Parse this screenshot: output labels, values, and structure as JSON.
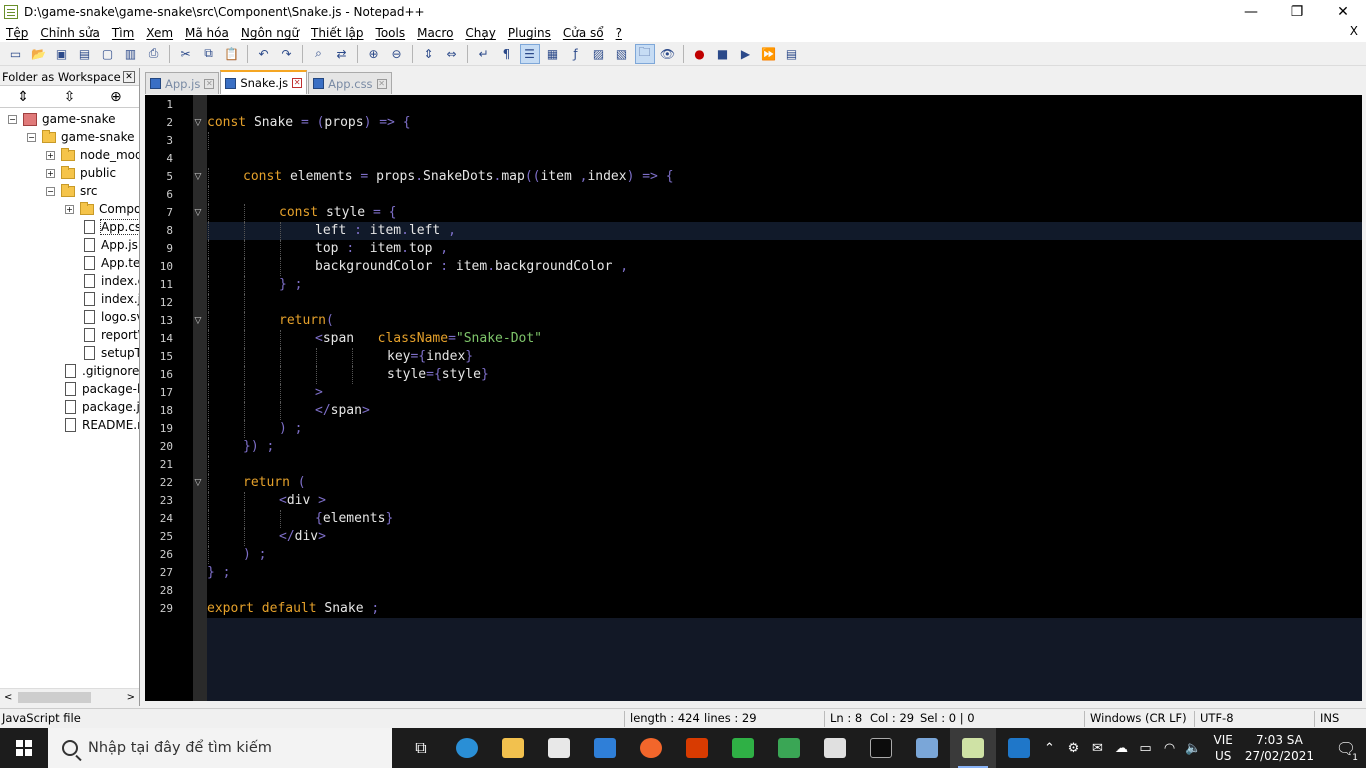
{
  "window": {
    "title": "D:\\game-snake\\game-snake\\src\\Component\\Snake.js - Notepad++",
    "controls": {
      "minimize": "—",
      "maximize": "❐",
      "close": "✕"
    }
  },
  "menu": {
    "items": [
      "Tệp",
      "Chỉnh sửa",
      "Tìm",
      "Xem",
      "Mã hóa",
      "Ngôn ngữ",
      "Thiết lập",
      "Tools",
      "Macro",
      "Chạy",
      "Plugins",
      "Cửa sổ",
      "?"
    ],
    "close": "X"
  },
  "toolbar": {
    "icons": [
      "new-file-icon",
      "open-file-icon",
      "save-icon",
      "save-all-icon",
      "close-icon",
      "close-all-icon",
      "print-icon",
      "cut-icon",
      "copy-icon",
      "paste-icon",
      "undo-icon",
      "redo-icon",
      "find-icon",
      "replace-icon",
      "zoom-in-icon",
      "zoom-out-icon",
      "sync-vertical-icon",
      "sync-horizontal-icon",
      "word-wrap-icon",
      "show-all-chars-icon",
      "indent-guide-icon",
      "doc-map-icon",
      "function-list-icon",
      "folder-workspace-icon",
      "monitoring-icon",
      "record-macro-icon",
      "stop-record-icon",
      "play-macro-icon",
      "run-macro-multiple-icon",
      "save-macro-icon"
    ]
  },
  "panel": {
    "title": "Folder as Workspace",
    "close": "✕",
    "tree": [
      {
        "label": "game-snake",
        "type": "project",
        "level": 0,
        "expander": "−"
      },
      {
        "label": "game-snake",
        "type": "folder",
        "level": 1,
        "expander": "−"
      },
      {
        "label": "node_modules",
        "type": "folder",
        "level": 2,
        "expander": "+"
      },
      {
        "label": "public",
        "type": "folder",
        "level": 2,
        "expander": "+"
      },
      {
        "label": "src",
        "type": "folder",
        "level": 2,
        "expander": "−"
      },
      {
        "label": "Component",
        "type": "folder",
        "level": 3,
        "expander": "+"
      },
      {
        "label": "App.css",
        "type": "file",
        "level": 3,
        "selected": true
      },
      {
        "label": "App.js",
        "type": "file",
        "level": 3
      },
      {
        "label": "App.test.js",
        "type": "file",
        "level": 3
      },
      {
        "label": "index.css",
        "type": "file",
        "level": 3
      },
      {
        "label": "index.js",
        "type": "file",
        "level": 3
      },
      {
        "label": "logo.svg",
        "type": "file",
        "level": 3
      },
      {
        "label": "reportWebVitals.js",
        "type": "file",
        "level": 3
      },
      {
        "label": "setupTests.js",
        "type": "file",
        "level": 3
      },
      {
        "label": ".gitignore",
        "type": "file",
        "level": 2
      },
      {
        "label": "package-lock.json",
        "type": "file",
        "level": 2
      },
      {
        "label": "package.json",
        "type": "file",
        "level": 2
      },
      {
        "label": "README.md",
        "type": "file",
        "level": 2
      }
    ]
  },
  "tabs": [
    {
      "label": "App.js",
      "active": false
    },
    {
      "label": "Snake.js",
      "active": true
    },
    {
      "label": "App.css",
      "active": false
    }
  ],
  "editor": {
    "current_line": 8,
    "lines": [
      {
        "n": 1,
        "fold": "",
        "indent": 0,
        "tokens": []
      },
      {
        "n": 2,
        "fold": "▽",
        "indent": 0,
        "tokens": [
          [
            "kw",
            "const"
          ],
          [
            "pl",
            " Snake "
          ],
          [
            "op",
            "= ("
          ],
          [
            "pl",
            "props"
          ],
          [
            "op",
            ") => {"
          ]
        ]
      },
      {
        "n": 3,
        "fold": "",
        "indent": 1,
        "tokens": []
      },
      {
        "n": 4,
        "fold": "",
        "indent": 0,
        "tokens": []
      },
      {
        "n": 5,
        "fold": "▽",
        "indent": 1,
        "tokens": [
          [
            "kw",
            "const"
          ],
          [
            "pl",
            " elements "
          ],
          [
            "op",
            "="
          ],
          [
            "pl",
            " props"
          ],
          [
            "op",
            "."
          ],
          [
            "pl",
            "SnakeDots"
          ],
          [
            "op",
            "."
          ],
          [
            "pl",
            "map"
          ],
          [
            "op",
            "(("
          ],
          [
            "pl",
            "item "
          ],
          [
            "op",
            ","
          ],
          [
            "pl",
            "index"
          ],
          [
            "op",
            ") => {"
          ]
        ]
      },
      {
        "n": 6,
        "fold": "",
        "indent": 1,
        "tokens": []
      },
      {
        "n": 7,
        "fold": "▽",
        "indent": 2,
        "tokens": [
          [
            "kw",
            "const"
          ],
          [
            "pl",
            " style "
          ],
          [
            "op",
            "= {"
          ]
        ]
      },
      {
        "n": 8,
        "fold": "",
        "indent": 3,
        "tokens": [
          [
            "pl",
            "left "
          ],
          [
            "op",
            ":"
          ],
          [
            "pl",
            " item"
          ],
          [
            "op",
            "."
          ],
          [
            "pl",
            "left "
          ],
          [
            "op",
            ","
          ]
        ]
      },
      {
        "n": 9,
        "fold": "",
        "indent": 3,
        "tokens": [
          [
            "pl",
            "top "
          ],
          [
            "op",
            ":"
          ],
          [
            "pl",
            "  item"
          ],
          [
            "op",
            "."
          ],
          [
            "pl",
            "top "
          ],
          [
            "op",
            ","
          ]
        ]
      },
      {
        "n": 10,
        "fold": "",
        "indent": 3,
        "tokens": [
          [
            "pl",
            "backgroundColor "
          ],
          [
            "op",
            ":"
          ],
          [
            "pl",
            " item"
          ],
          [
            "op",
            "."
          ],
          [
            "pl",
            "backgroundColor "
          ],
          [
            "op",
            ","
          ]
        ]
      },
      {
        "n": 11,
        "fold": "",
        "indent": 2,
        "tokens": [
          [
            "op",
            "} ;"
          ]
        ]
      },
      {
        "n": 12,
        "fold": "",
        "indent": 2,
        "tokens": []
      },
      {
        "n": 13,
        "fold": "▽",
        "indent": 2,
        "tokens": [
          [
            "kw",
            "return"
          ],
          [
            "op",
            "("
          ]
        ]
      },
      {
        "n": 14,
        "fold": "",
        "indent": 3,
        "tokens": [
          [
            "op",
            "<"
          ],
          [
            "pl",
            "span   "
          ],
          [
            "kw",
            "className"
          ],
          [
            "op",
            "="
          ],
          [
            "str",
            "\"Snake-Dot\""
          ]
        ]
      },
      {
        "n": 15,
        "fold": "",
        "indent": 5,
        "tokens": [
          [
            "pl",
            "key"
          ],
          [
            "op",
            "={"
          ],
          [
            "pl",
            "index"
          ],
          [
            "op",
            "}"
          ]
        ]
      },
      {
        "n": 16,
        "fold": "",
        "indent": 5,
        "tokens": [
          [
            "pl",
            "style"
          ],
          [
            "op",
            "={"
          ],
          [
            "pl",
            "style"
          ],
          [
            "op",
            "}"
          ]
        ]
      },
      {
        "n": 17,
        "fold": "",
        "indent": 3,
        "tokens": [
          [
            "op",
            ">"
          ]
        ]
      },
      {
        "n": 18,
        "fold": "",
        "indent": 3,
        "tokens": [
          [
            "op",
            "</"
          ],
          [
            "pl",
            "span"
          ],
          [
            "op",
            ">"
          ]
        ]
      },
      {
        "n": 19,
        "fold": "",
        "indent": 2,
        "tokens": [
          [
            "op",
            ") ;"
          ]
        ]
      },
      {
        "n": 20,
        "fold": "",
        "indent": 1,
        "tokens": [
          [
            "op",
            "}) ;"
          ]
        ]
      },
      {
        "n": 21,
        "fold": "",
        "indent": 1,
        "tokens": []
      },
      {
        "n": 22,
        "fold": "▽",
        "indent": 1,
        "tokens": [
          [
            "kw",
            "return"
          ],
          [
            "op",
            " ("
          ]
        ]
      },
      {
        "n": 23,
        "fold": "",
        "indent": 2,
        "tokens": [
          [
            "op",
            "<"
          ],
          [
            "pl",
            "div "
          ],
          [
            "op",
            ">"
          ]
        ]
      },
      {
        "n": 24,
        "fold": "",
        "indent": 3,
        "tokens": [
          [
            "op",
            "{"
          ],
          [
            "pl",
            "elements"
          ],
          [
            "op",
            "}"
          ]
        ]
      },
      {
        "n": 25,
        "fold": "",
        "indent": 2,
        "tokens": [
          [
            "op",
            "</"
          ],
          [
            "pl",
            "div"
          ],
          [
            "op",
            ">"
          ]
        ]
      },
      {
        "n": 26,
        "fold": "",
        "indent": 1,
        "tokens": [
          [
            "op",
            ") ;"
          ]
        ]
      },
      {
        "n": 27,
        "fold": "",
        "indent": 0,
        "tokens": [
          [
            "op",
            "} ;"
          ]
        ]
      },
      {
        "n": 28,
        "fold": "",
        "indent": 0,
        "tokens": []
      },
      {
        "n": 29,
        "fold": "",
        "indent": 0,
        "tokens": [
          [
            "kw",
            "export default"
          ],
          [
            "pl",
            " Snake "
          ],
          [
            "op",
            ";"
          ]
        ]
      }
    ]
  },
  "status": {
    "file_type": "JavaScript file",
    "length": "length : 424",
    "lines": "lines : 29",
    "ln": "Ln : 8",
    "col": "Col : 29",
    "sel": "Sel : 0 | 0",
    "eol": "Windows (CR LF)",
    "encoding": "UTF-8",
    "mode": "INS"
  },
  "taskbar": {
    "search_placeholder": "Nhập tại đây để tìm kiếm",
    "apps": [
      "task-view-icon",
      "edge-icon",
      "file-explorer-icon",
      "store-icon",
      "mail-icon",
      "firefox-icon",
      "office-icon",
      "wechat-icon",
      "notepad-icon",
      "slack-icon",
      "terminal-icon",
      "paint-icon",
      "notepadpp-icon",
      "photos-icon"
    ],
    "lang_top": "VIE",
    "lang_bottom": "US",
    "time": "7:03 SA",
    "date": "27/02/2021",
    "notifications": "1"
  }
}
